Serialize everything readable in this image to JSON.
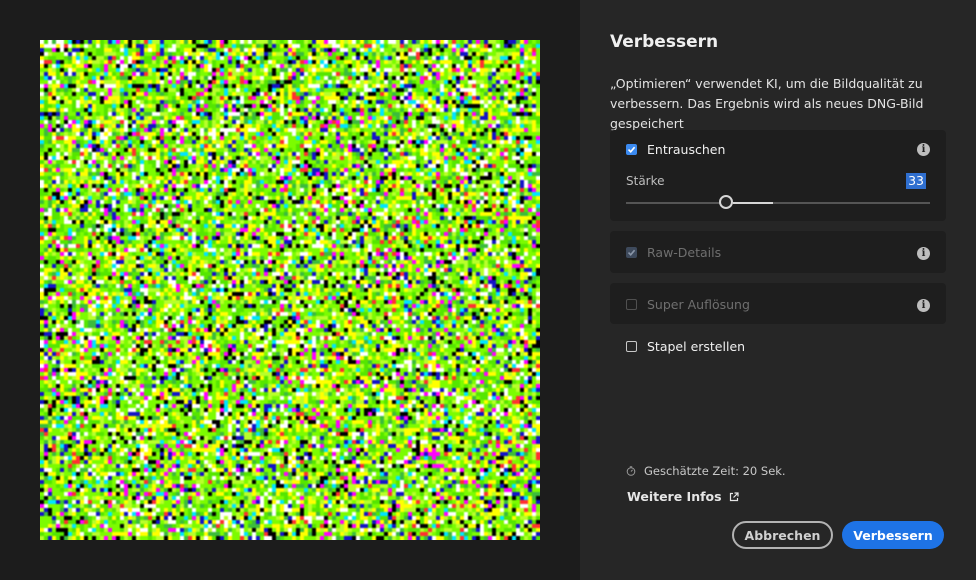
{
  "dialog": {
    "title": "Verbessern",
    "description": "„Optimieren“ verwendet KI, um die Bildqualität zu verbessern. Das Ergebnis wird als neues DNG-Bild gespeichert"
  },
  "options": {
    "denoise": {
      "label": "Entrauschen",
      "checked": true,
      "enabled": true,
      "info_icon": "info-icon"
    },
    "strength": {
      "label": "Stärke",
      "value": "33",
      "level": 0.33
    },
    "raw_details": {
      "label": "Raw-Details",
      "checked": true,
      "enabled": false,
      "info_icon": "info-icon"
    },
    "super_resolution": {
      "label": "Super Auflösung",
      "checked": false,
      "enabled": false,
      "info_icon": "info-icon"
    },
    "create_stack": {
      "label": "Stapel erstellen",
      "checked": false,
      "enabled": true
    }
  },
  "footer": {
    "estimated_time": "Geschätzte Zeit: 20 Sek.",
    "more_info": "Weitere Infos",
    "cancel_label": "Abbrechen",
    "enhance_label": "Verbessern"
  },
  "colors": {
    "primary_button": "#1e73e6",
    "checkbox_checked": "#3b8af0",
    "value_highlight": "#2f6fd0",
    "preview_noise": [
      "#7cfc00",
      "#55e600",
      "#b8ff2a",
      "#ffff00",
      "#ffffff",
      "#000000",
      "#1414c8",
      "#ff00ff",
      "#00e5ff",
      "#ff3030",
      "#3cbc3c"
    ]
  }
}
